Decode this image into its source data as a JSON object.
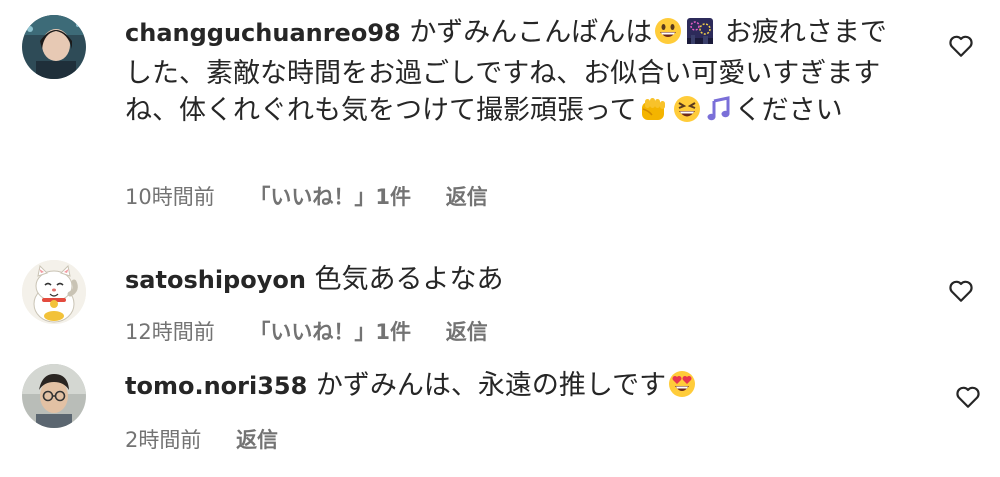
{
  "comments": [
    {
      "username": "changguchuanreo98",
      "text_1": "かずみんこんばんは",
      "text_2": "お疲れさまでした、素敵な時間をお過ごしですね、お似合い可愛いすぎますね、体くれぐれも気をつけて撮影頑張って",
      "text_3": "ください",
      "time": "10時間前",
      "likes": "「いいね！」1件",
      "reply": "返信",
      "icons": [
        "grin-emoji",
        "fireworks-emoji",
        "fist-emoji",
        "laugh-emoji",
        "music-note-emoji"
      ]
    },
    {
      "username": "satoshipoyon",
      "text": "色気あるよなあ",
      "time": "12時間前",
      "likes": "「いいね！」1件",
      "reply": "返信",
      "icons": [
        "lucky-cat-avatar"
      ]
    },
    {
      "username": "tomo.nori358",
      "text": "かずみんは、永遠の推しです",
      "time": "2時間前",
      "reply": "返信",
      "icons": [
        "heart-eyes-emoji"
      ]
    }
  ],
  "colors": {
    "text": "#262626",
    "meta": "#737373",
    "background": "#ffffff"
  }
}
